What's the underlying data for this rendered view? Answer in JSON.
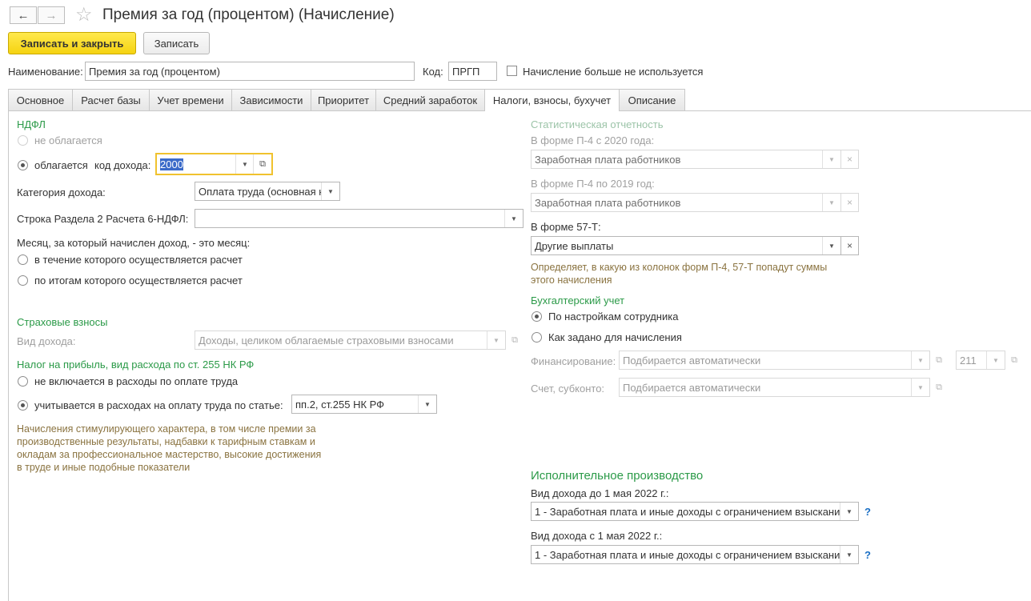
{
  "window": {
    "title": "Премия за год (процентом) (Начисление)",
    "back_icon": "←",
    "forward_icon": "→",
    "star_icon": "☆"
  },
  "toolbar": {
    "save_close_label": "Записать и закрыть",
    "save_label": "Записать"
  },
  "header": {
    "name_label": "Наименование:",
    "name_value": "Премия за год (процентом)",
    "code_label": "Код:",
    "code_value": "ПРГП",
    "unused_label": "Начисление больше не используется"
  },
  "tabs": [
    "Основное",
    "Расчет базы",
    "Учет времени",
    "Зависимости",
    "Приоритет",
    "Средний заработок",
    "Налоги, взносы, бухучет",
    "Описание"
  ],
  "ndfl": {
    "section_title": "НДФЛ",
    "not_taxed_label": "не облагается",
    "taxed_label": "облагается",
    "income_code_label": "код дохода:",
    "income_code_value": "2000",
    "category_label": "Категория дохода:",
    "category_value": "Оплата труда (основная н",
    "line6_label": "Строка Раздела 2 Расчета 6-НДФЛ:",
    "line6_value": "",
    "month_label": "Месяц, за который начислен доход, - это месяц:",
    "month_option1": "в течение которого осуществляется расчет",
    "month_option2": "по итогам которого осуществляется расчет"
  },
  "insurance": {
    "section_title": "Страховые взносы",
    "income_type_label": "Вид дохода:",
    "income_type_value": "Доходы, целиком облагаемые страховыми взносами"
  },
  "profit_tax": {
    "section_title": "Налог на прибыль, вид расхода по ст. 255 НК РФ",
    "option1": "не включается в расходы по оплате труда",
    "option2": "учитывается в расходах на оплату труда по статье:",
    "article_value": "пп.2, ст.255 НК РФ",
    "note": [
      "Начисления стимулирующего характера, в том числе премии за",
      "производственные результаты, надбавки к тарифным ставкам и",
      "окладам за профессиональное мастерство, высокие достижения",
      "в труде и иные подобные показатели"
    ]
  },
  "statistics": {
    "section_title": "Статистическая отчетность",
    "p4_2020_label": "В форме П-4 с 2020 года:",
    "p4_2020_value": "Заработная плата работников",
    "p4_2019_label": "В форме П-4 по 2019 год:",
    "p4_2019_value": "Заработная плата работников",
    "f57_label": "В форме 57-Т:",
    "f57_value": "Другие выплаты",
    "note": [
      "Определяет, в какую из колонок форм П-4, 57-Т попадут суммы",
      "этого начисления"
    ]
  },
  "accounting": {
    "section_title": "Бухгалтерский учет",
    "option1": "По настройкам сотрудника",
    "option2": "Как задано для начисления",
    "financing_label": "Финансирование:",
    "financing_value": "Подбирается автоматически",
    "financing_code": "211",
    "account_label": "Счет, субконто:",
    "account_value": "Подбирается автоматически"
  },
  "enforcement": {
    "section_title": "Исполнительное производство",
    "before_label": "Вид дохода до 1 мая 2022 г.:",
    "before_value": "1 - Заработная плата и иные доходы с ограничением взыскани:",
    "after_label": "Вид дохода с 1 мая 2022 г.:",
    "after_value": "1 - Заработная плата и иные доходы с ограничением взыскани:",
    "help": "?"
  },
  "icons": {
    "dropdown": "▼",
    "clear": "×",
    "open": "⧉"
  }
}
